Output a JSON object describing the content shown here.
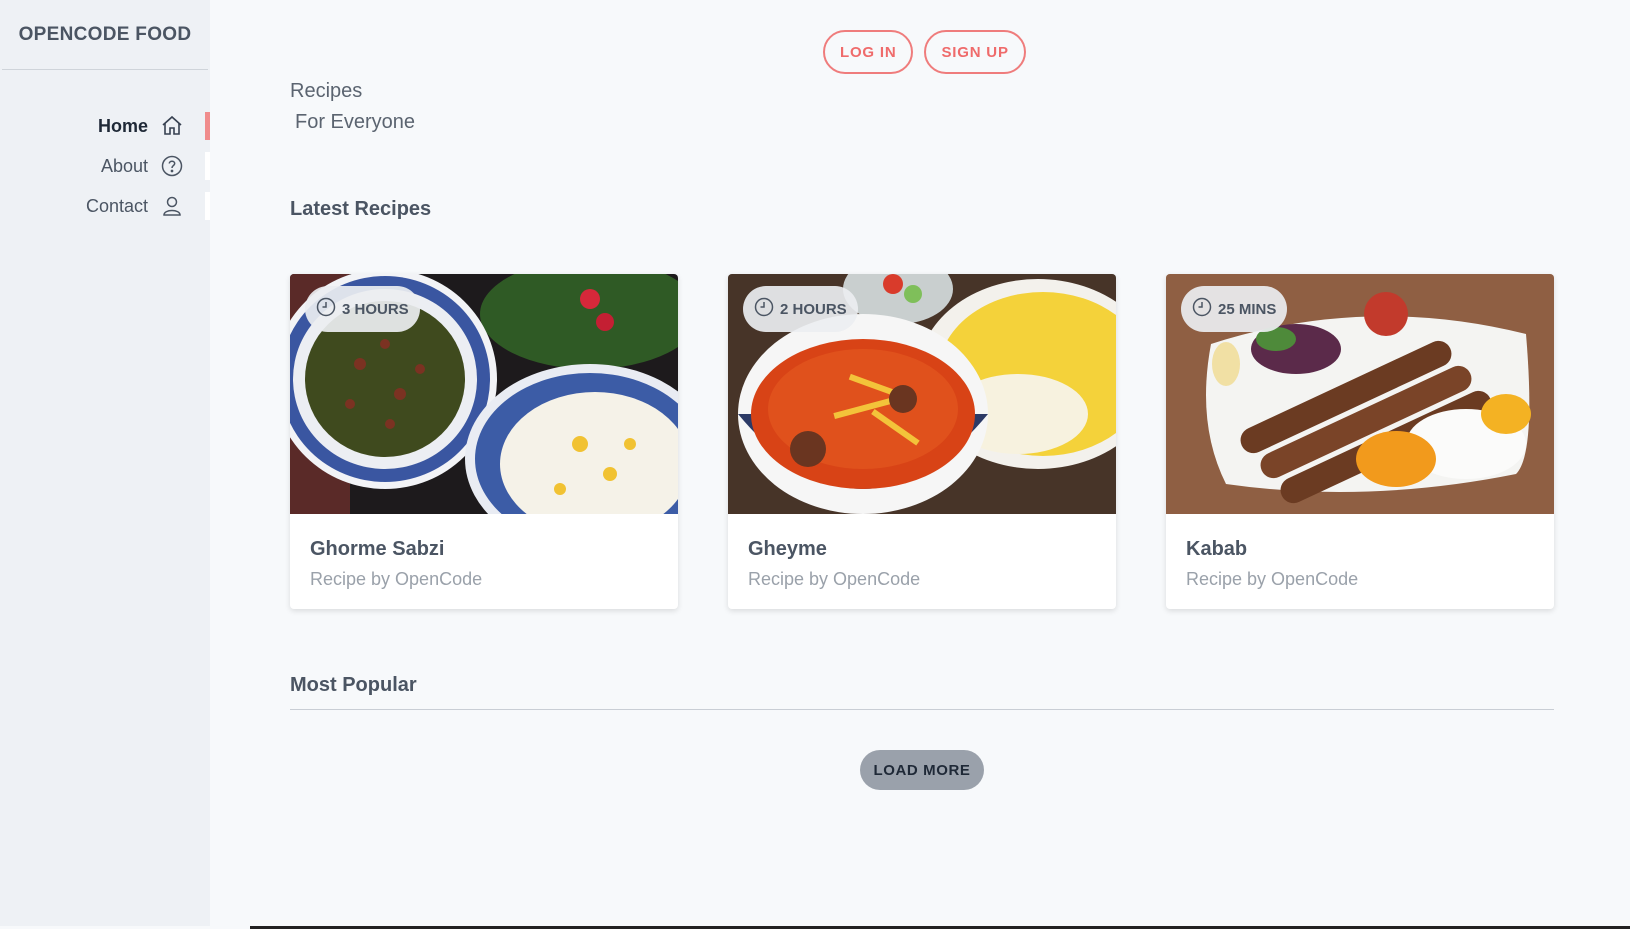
{
  "app": {
    "brand": "OPENCODE FOOD"
  },
  "nav": {
    "items": [
      {
        "label": "Home",
        "icon": "home-icon",
        "active": true
      },
      {
        "label": "About",
        "icon": "question-circle-icon",
        "active": false
      },
      {
        "label": "Contact",
        "icon": "user-icon",
        "active": false
      }
    ]
  },
  "auth": {
    "login_label": "LOG IN",
    "signup_label": "SIGN UP"
  },
  "hero": {
    "line1": "Recipes",
    "line2": "For Everyone"
  },
  "sections": {
    "latest": "Latest Recipes",
    "popular": "Most Popular"
  },
  "recipes": [
    {
      "time": "3 HOURS",
      "title": "Ghorme Sabzi",
      "byline": "Recipe by OpenCode"
    },
    {
      "time": "2 HOURS",
      "title": "Gheyme",
      "byline": "Recipe by OpenCode"
    },
    {
      "time": "25 MINS",
      "title": "Kabab",
      "byline": "Recipe by OpenCode"
    }
  ],
  "actions": {
    "load_more": "LOAD MORE"
  },
  "colors": {
    "accent": "#ef6b6b",
    "sidebar_bg": "#eef1f5",
    "page_bg": "#f7f9fb"
  }
}
